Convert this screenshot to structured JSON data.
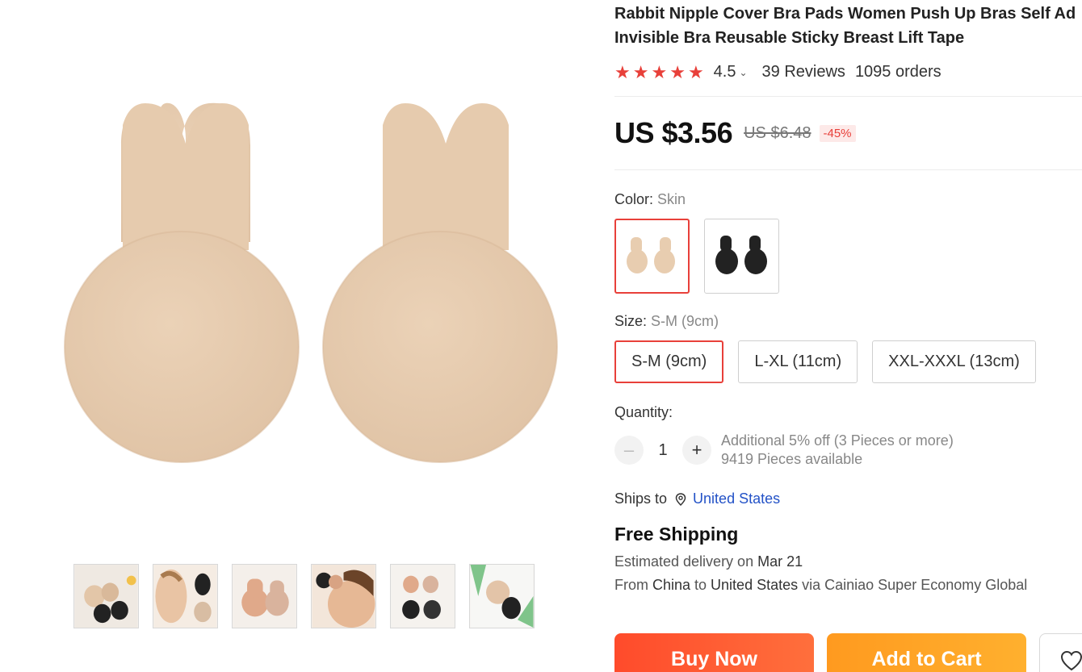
{
  "product": {
    "title_line1": "Rabbit Nipple Cover Bra Pads Women Push Up Bras Self Ad",
    "title_line2": "Invisible Bra Reusable Sticky Breast Lift Tape",
    "rating": "4.5",
    "rating_stars": 5,
    "reviews": "39 Reviews",
    "orders": "1095 orders"
  },
  "price": {
    "current": "US $3.56",
    "original": "US $6.48",
    "discount": "-45%"
  },
  "color": {
    "label": "Color: ",
    "selected": "Skin",
    "options": [
      {
        "name": "skin-swatch",
        "color": "#e8cdb0",
        "selected": true
      },
      {
        "name": "black-swatch",
        "color": "#222222",
        "selected": false
      }
    ]
  },
  "size": {
    "label": "Size: ",
    "selected": "S-M (9cm)",
    "options": [
      "S-M (9cm)",
      "L-XL (11cm)",
      "XXL-XXXL (13cm)"
    ]
  },
  "quantity": {
    "label": "Quantity:",
    "value": "1",
    "minus": "–",
    "plus": "+",
    "promo": "Additional 5% off (3 Pieces or more)",
    "available": "9419 Pieces available"
  },
  "shipping": {
    "ships_to_label": "Ships to",
    "destination": "United States",
    "free_shipping": "Free Shipping",
    "est_prefix": "Estimated delivery on ",
    "est_date": "Mar 21",
    "from_prefix": "From ",
    "from": "China",
    "to_word": " to ",
    "to": "United States",
    "via": " via Cainiao Super Economy Global"
  },
  "actions": {
    "buy_now": "Buy Now",
    "add_to_cart": "Add to Cart"
  },
  "colors": {
    "accent": "#e8403a",
    "link": "#2352c7",
    "skin": "#e8cdb0",
    "buy_start": "#ff4b2b",
    "cart_start": "#ff9a1f"
  }
}
